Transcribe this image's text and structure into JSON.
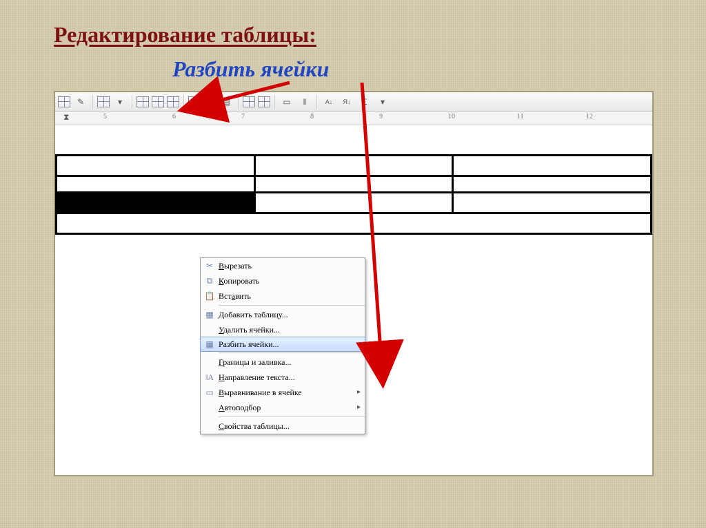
{
  "slide": {
    "title": " Редактирование таблицы:",
    "subtitle": "Разбить ячейки"
  },
  "ruler": {
    "ticks": [
      "5",
      "6",
      "7",
      "8",
      "9",
      "10",
      "11",
      "12"
    ]
  },
  "toolbar": {
    "icons": [
      "table-icon",
      "eraser-icon",
      "line-style-icon",
      "border-icon",
      "table-grid-icon",
      "table-insert-icon",
      "table-delete-icon",
      "merge-cells-icon",
      "split-cells-icon",
      "split-table-icon",
      "align-cell-icon",
      "distribute-rows-icon",
      "distribute-cols-icon",
      "table-autoformat-icon",
      "sort-az-icon",
      "sort-za-icon",
      "autosum-icon"
    ]
  },
  "context_menu": [
    {
      "icon": "cut-icon",
      "label": "Вырезать",
      "ul": 0,
      "sep": false,
      "sub": false,
      "hl": false
    },
    {
      "icon": "copy-icon",
      "label": "Копировать",
      "ul": 0,
      "sep": false,
      "sub": false,
      "hl": false
    },
    {
      "icon": "paste-icon",
      "label": "Вставить",
      "ul": 3,
      "sep": false,
      "sub": false,
      "hl": false
    },
    {
      "icon": "",
      "label": "",
      "ul": -1,
      "sep": true,
      "sub": false,
      "hl": false
    },
    {
      "icon": "table-insert-icon",
      "label": "Добавить таблицу...",
      "ul": 0,
      "sep": false,
      "sub": false,
      "hl": false
    },
    {
      "icon": "",
      "label": "Удалить ячейки...",
      "ul": 0,
      "sep": false,
      "sub": false,
      "hl": false
    },
    {
      "icon": "split-cells-icon",
      "label": "Разбить ячейки...",
      "ul": -1,
      "sep": false,
      "sub": false,
      "hl": true
    },
    {
      "icon": "",
      "label": "",
      "ul": -1,
      "sep": true,
      "sub": false,
      "hl": false
    },
    {
      "icon": "",
      "label": "Границы и заливка...",
      "ul": 0,
      "sep": false,
      "sub": false,
      "hl": false
    },
    {
      "icon": "text-dir-icon",
      "label": "Направление текста...",
      "ul": 0,
      "sep": false,
      "sub": false,
      "hl": false
    },
    {
      "icon": "align-cell-icon",
      "label": "Выравнивание в ячейке",
      "ul": 0,
      "sep": false,
      "sub": true,
      "hl": false
    },
    {
      "icon": "",
      "label": "Автоподбор",
      "ul": 0,
      "sep": false,
      "sub": true,
      "hl": false
    },
    {
      "icon": "",
      "label": "",
      "ul": -1,
      "sep": true,
      "sub": false,
      "hl": false
    },
    {
      "icon": "",
      "label": "Свойства таблицы...",
      "ul": 0,
      "sep": false,
      "sub": false,
      "hl": false
    }
  ]
}
